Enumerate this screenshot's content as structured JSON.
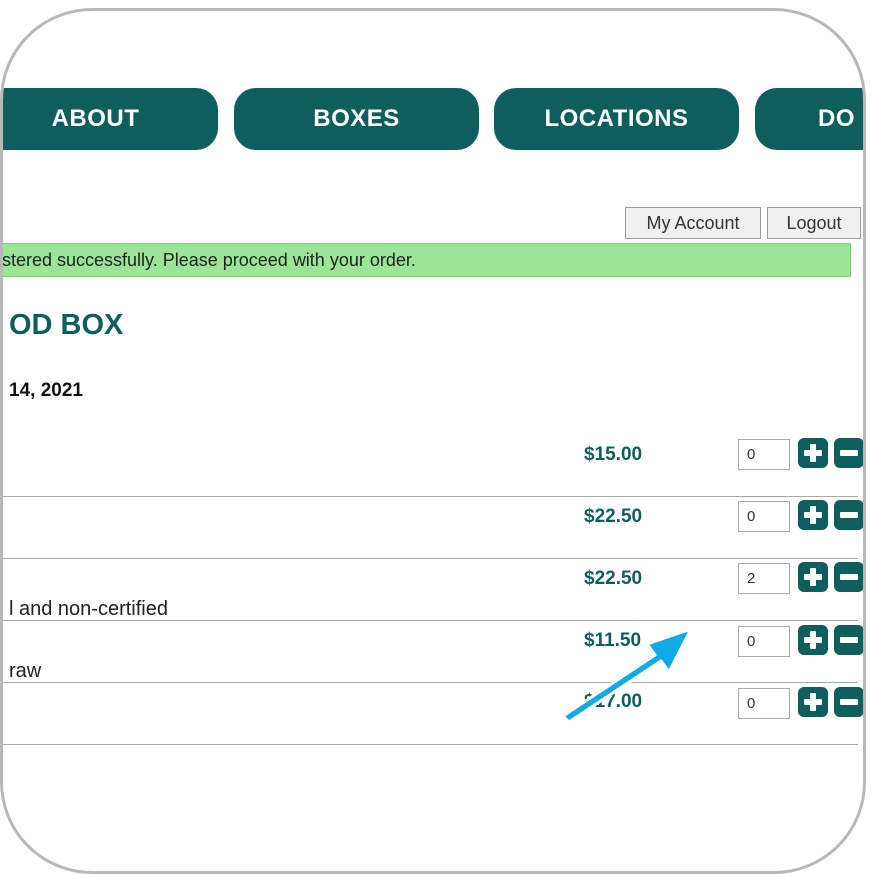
{
  "nav": {
    "items": [
      {
        "label": "ABOUT"
      },
      {
        "label": "BOXES"
      },
      {
        "label": "LOCATIONS"
      },
      {
        "label": "DO"
      }
    ]
  },
  "account": {
    "my_account": "My Account",
    "logout": "Logout"
  },
  "notice": "stered successfully. Please proceed with your order.",
  "heading": "OD BOX",
  "date": "14, 2021",
  "items": [
    {
      "price": "$15.00",
      "qty": "0",
      "desc": ""
    },
    {
      "price": "$22.50",
      "qty": "0",
      "desc": ""
    },
    {
      "price": "$22.50",
      "qty": "2",
      "desc": "l and non-certified"
    },
    {
      "price": "$11.50",
      "qty": "0",
      "desc": "raw"
    },
    {
      "price": "$17.00",
      "qty": "0",
      "desc": ""
    }
  ],
  "colors": {
    "brand": "#0e5e5e",
    "notice_bg": "#9be598",
    "arrow": "#11a9e6"
  },
  "icons": [
    "plus-icon",
    "minus-icon",
    "pointer-arrow-icon"
  ]
}
